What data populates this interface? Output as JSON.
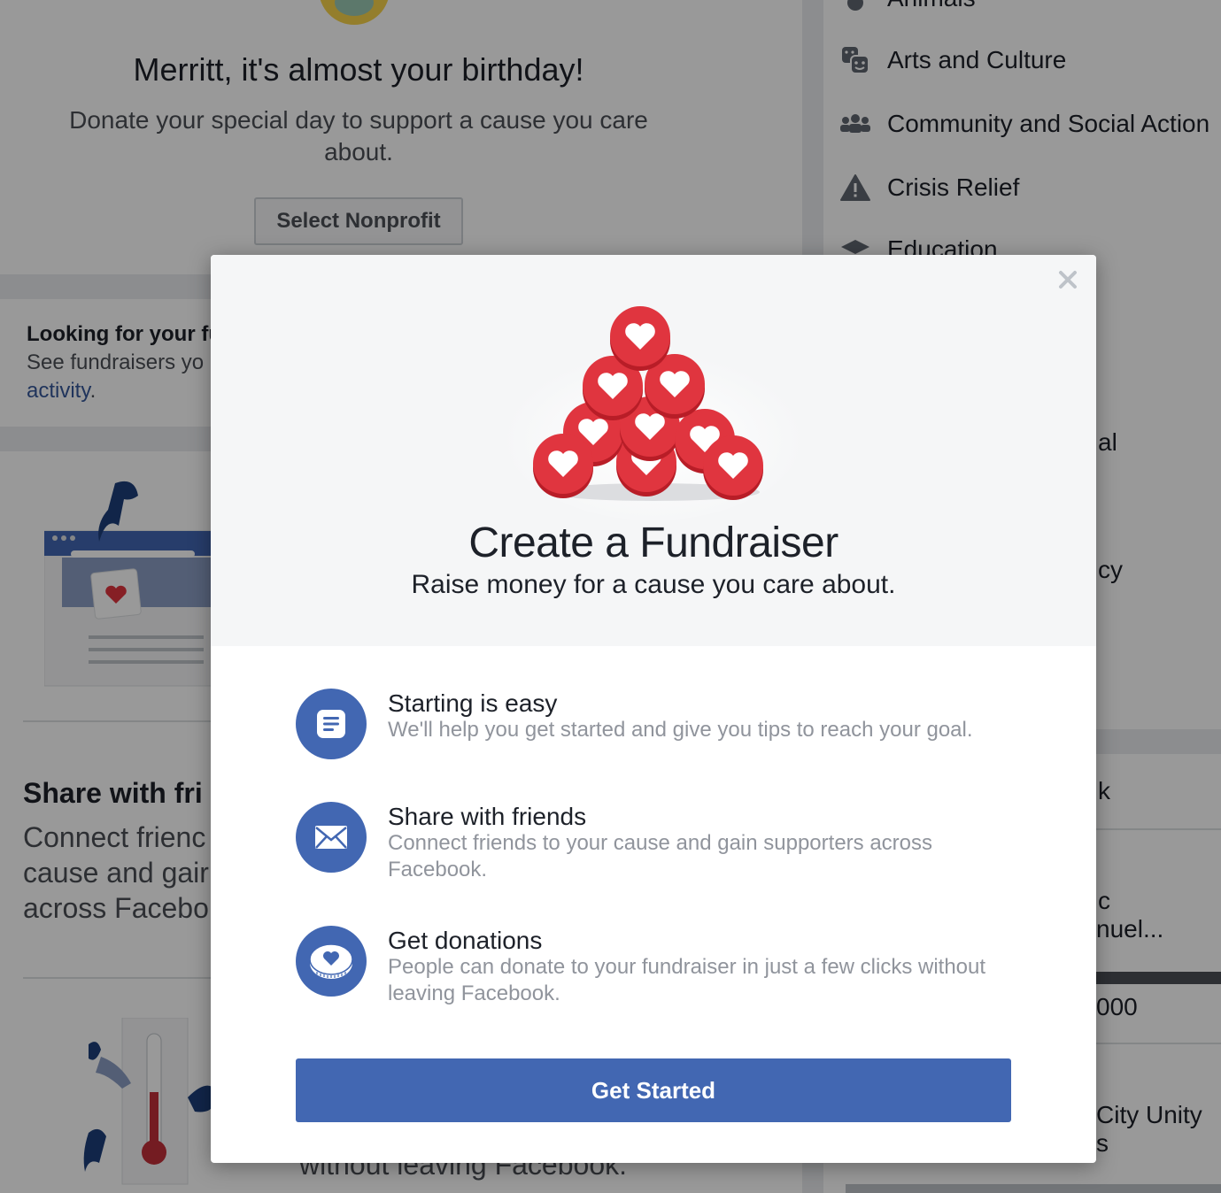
{
  "background": {
    "birthday": {
      "title": "Merritt, it's almost your birthday!",
      "subtitle": "Donate your special day to support a cause you care about.",
      "button_label": "Select Nonprofit"
    },
    "looking": {
      "title_partial": "Looking for your fu",
      "subtitle_partial": "See fundraisers yo",
      "link_label": "activity",
      "link_suffix": "."
    },
    "share": {
      "title_partial": "Share with fri",
      "subtitle_partial": "Connect frienc cause and gair across Facebo"
    },
    "leaving_partial": "without leaving Facebook.",
    "categories": [
      {
        "label": "Animals",
        "icon": "paw-icon"
      },
      {
        "label": "Arts and Culture",
        "icon": "theater-masks-icon"
      },
      {
        "label": "Community and Social Action",
        "icon": "people-icon"
      },
      {
        "label": "Crisis Relief",
        "icon": "warning-icon"
      },
      {
        "label": "Education",
        "icon": "graduation-cap-icon"
      }
    ],
    "right_fragments": {
      "frag_al": "al",
      "frag_cy": "cy",
      "frag_k": "k",
      "frag_c": "c",
      "frag_nuel": "nuel...",
      "frag_000": "000",
      "frag_city": "City Unity",
      "frag_s": "s"
    }
  },
  "modal": {
    "title": "Create a Fundraiser",
    "subtitle": "Raise money for a cause you care about.",
    "close_icon": "close-icon",
    "features": [
      {
        "icon": "document-icon",
        "title": "Starting is easy",
        "description": "We'll help you get started and give you tips to reach your goal."
      },
      {
        "icon": "envelope-icon",
        "title": "Share with friends",
        "description": "Connect friends to your cause and gain supporters across Facebook."
      },
      {
        "icon": "heart-coin-icon",
        "title": "Get donations",
        "description": "People can donate to your fundraiser in just a few clicks without leaving Facebook."
      }
    ],
    "cta_label": "Get Started"
  },
  "colors": {
    "brand_blue": "#4267b2",
    "link_blue": "#365899",
    "heart_red": "#e0353f",
    "muted_text": "#90949c"
  }
}
